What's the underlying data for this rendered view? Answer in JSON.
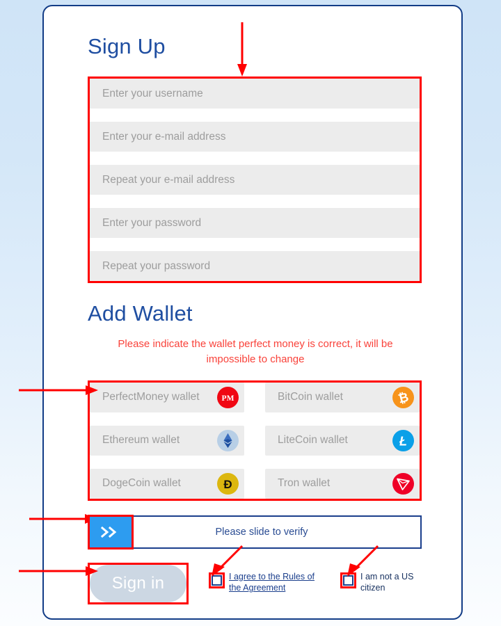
{
  "card": {
    "signup_heading": "Sign Up",
    "wallet_heading": "Add Wallet",
    "warning": "Please indicate the wallet perfect money is correct, it will be impossible to change"
  },
  "signup_fields": [
    {
      "name": "username",
      "placeholder": "Enter your username"
    },
    {
      "name": "email",
      "placeholder": "Enter your e-mail address"
    },
    {
      "name": "email-repeat",
      "placeholder": "Repeat your e-mail address"
    },
    {
      "name": "password",
      "placeholder": "Enter your password"
    },
    {
      "name": "password-repeat",
      "placeholder": "Repeat your password"
    }
  ],
  "wallets": [
    {
      "name": "perfectmoney",
      "placeholder": "PerfectMoney wallet",
      "icon": "perfectmoney-icon",
      "color": "#f00713"
    },
    {
      "name": "bitcoin",
      "placeholder": "BitCoin wallet",
      "icon": "bitcoin-icon",
      "color": "#f7931a"
    },
    {
      "name": "ethereum",
      "placeholder": "Ethereum wallet",
      "icon": "ethereum-icon",
      "color": "#b8cfe6"
    },
    {
      "name": "litecoin",
      "placeholder": "LiteCoin wallet",
      "icon": "litecoin-icon",
      "color": "#0ba0e8"
    },
    {
      "name": "dogecoin",
      "placeholder": "DogeCoin wallet",
      "icon": "dogecoin-icon",
      "color": "#dcb70f"
    },
    {
      "name": "tron",
      "placeholder": "Tron wallet",
      "icon": "tron-icon",
      "color": "#ef0027"
    }
  ],
  "slider": {
    "text": "Please slide to verify",
    "handle_icon": "double-chevron-right-icon",
    "handle_color": "#2d9cf0"
  },
  "actions": {
    "signin_label": "Sign in",
    "signin_disabled": true
  },
  "checkboxes": [
    {
      "name": "rules-agreement",
      "label": "I agree to the Rules of the Agreement",
      "is_link": true,
      "checked": false
    },
    {
      "name": "us-citizen",
      "label": "I am not a US citizen",
      "is_link": false,
      "checked": false
    }
  ],
  "colors": {
    "heading": "#1f4ea1",
    "warning": "#f9423a",
    "annotation": "#ff0000",
    "card_border": "#123c86",
    "field_bg": "#ececec",
    "placeholder": "#9d9d9d"
  }
}
